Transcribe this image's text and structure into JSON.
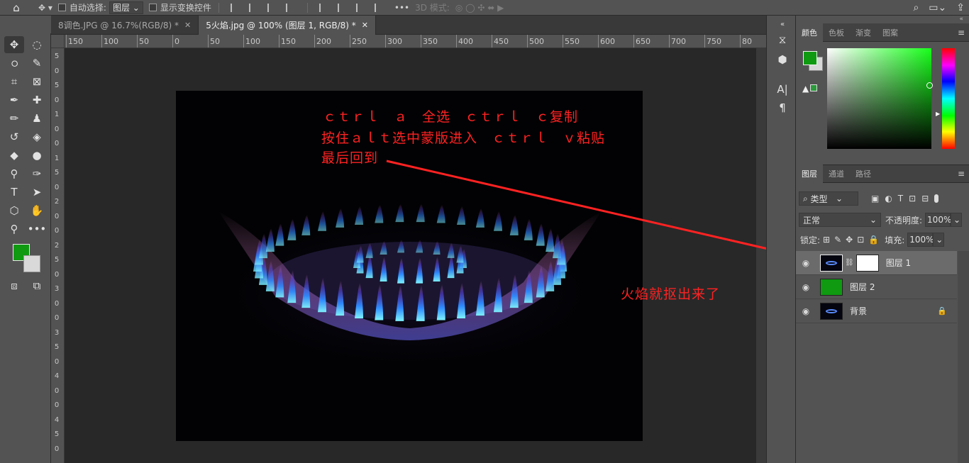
{
  "topbar": {
    "auto_select_label": "自动选择:",
    "auto_select_value": "图层",
    "show_transform_label": "显示变换控件",
    "mode_3d_label": "3D 模式:"
  },
  "tabs": [
    {
      "label": "8调色.JPG @ 16.7%(RGB/8) *",
      "active": false
    },
    {
      "label": "5火焰.jpg @ 100% (图层 1, RGB/8) *",
      "active": true
    }
  ],
  "ruler_h": [
    "150",
    "100",
    "50",
    "0",
    "50",
    "100",
    "150",
    "200",
    "250",
    "300",
    "350",
    "400",
    "450",
    "500",
    "550",
    "600",
    "650",
    "700",
    "750",
    "80"
  ],
  "ruler_v": [
    "5",
    "0",
    "5",
    "0",
    "1",
    "0",
    "0",
    "1",
    "5",
    "0",
    "2",
    "0",
    "0",
    "2",
    "5",
    "0",
    "3",
    "0",
    "0",
    "3",
    "5",
    "0",
    "4",
    "0",
    "0",
    "4",
    "5",
    "0"
  ],
  "annotations": {
    "line1": "ｃｔｒｌ　ａ　全选　ｃｔｒｌ　ｃ复制",
    "line2": "按住ａｌｔ选中蒙版进入　ｃｔｒｌ　ｖ粘贴",
    "line3": "最后回到",
    "result": "火焰就抠出来了",
    "color": "#ff2222"
  },
  "color_panel": {
    "tabs": [
      "颜色",
      "色板",
      "渐变",
      "图案"
    ],
    "foreground": "#0f9a11",
    "background": "#d7d7d7"
  },
  "layers_panel": {
    "tabs": [
      "图层",
      "通道",
      "路径"
    ],
    "filter_label": "类型",
    "blend_mode": "正常",
    "opacity_label": "不透明度:",
    "opacity_value": "100%",
    "lock_label": "锁定:",
    "fill_label": "填充:",
    "fill_value": "100%",
    "layers": [
      {
        "name": "图层 1",
        "selected": true,
        "has_mask": true
      },
      {
        "name": "图层 2",
        "selected": false,
        "has_mask": false
      },
      {
        "name": "背景",
        "selected": false,
        "has_mask": false,
        "locked": true
      }
    ]
  }
}
